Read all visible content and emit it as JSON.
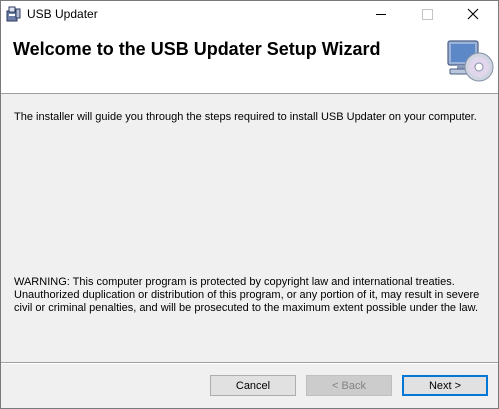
{
  "window": {
    "title": "USB Updater",
    "app_icon": "installer-package-icon"
  },
  "banner": {
    "heading": "Welcome to the USB Updater Setup Wizard",
    "icon": "computer-cd-icon"
  },
  "content": {
    "intro": "The installer will guide you through the steps required to install USB Updater on your computer.",
    "warning": "WARNING: This computer program is protected by copyright law and international treaties. Unauthorized duplication or distribution of this program, or any portion of it, may result in severe civil or criminal penalties, and will be prosecuted to the maximum extent possible under the law."
  },
  "buttons": {
    "cancel": "Cancel",
    "back": "< Back",
    "next": "Next >"
  },
  "colors": {
    "accent": "#0078d7",
    "dialog_bg": "#f0f0f0",
    "banner_bg": "#ffffff"
  }
}
